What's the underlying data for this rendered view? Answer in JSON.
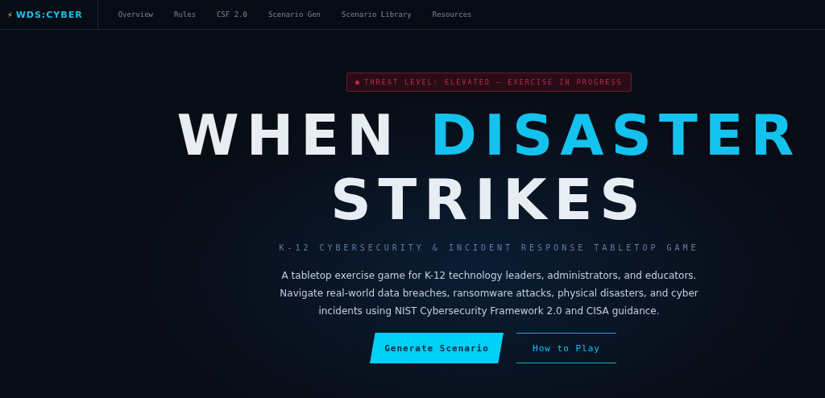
{
  "nav": {
    "logo_icon": "⚡",
    "logo": "WDS:CYBER",
    "links": [
      {
        "label": "Overview",
        "selected": false
      },
      {
        "label": "Rules",
        "selected": false
      },
      {
        "label": "CSF 2.0",
        "selected": false
      },
      {
        "label": "Scenario Gen",
        "selected": false
      },
      {
        "label": "Scenario Library",
        "selected": false
      },
      {
        "label": "Resources",
        "selected": false
      }
    ]
  },
  "hero": {
    "alert": "THREAT LEVEL: ELEVATED — EXERCISE IN PROGRESS",
    "title_lines": [
      [
        {
          "text": "WHEN",
          "accent": false
        },
        {
          "text": "DISASTER",
          "accent": true
        }
      ],
      [
        {
          "text": "STRIKES",
          "accent": false
        }
      ]
    ],
    "subtitle": "K-12 CYBERSECURITY & INCIDENT RESPONSE TABLETOP GAME",
    "description": "A tabletop exercise game for K-12 technology leaders, administrators, and educators. Navigate real-world data breaches, ransomware attacks, physical disasters, and cyber incidents using NIST Cybersecurity Framework 2.0 and CISA guidance.",
    "buttons": [
      {
        "label": "Generate Scenario",
        "kind": "primary"
      },
      {
        "label": "How to Play",
        "kind": "outline"
      }
    ]
  }
}
